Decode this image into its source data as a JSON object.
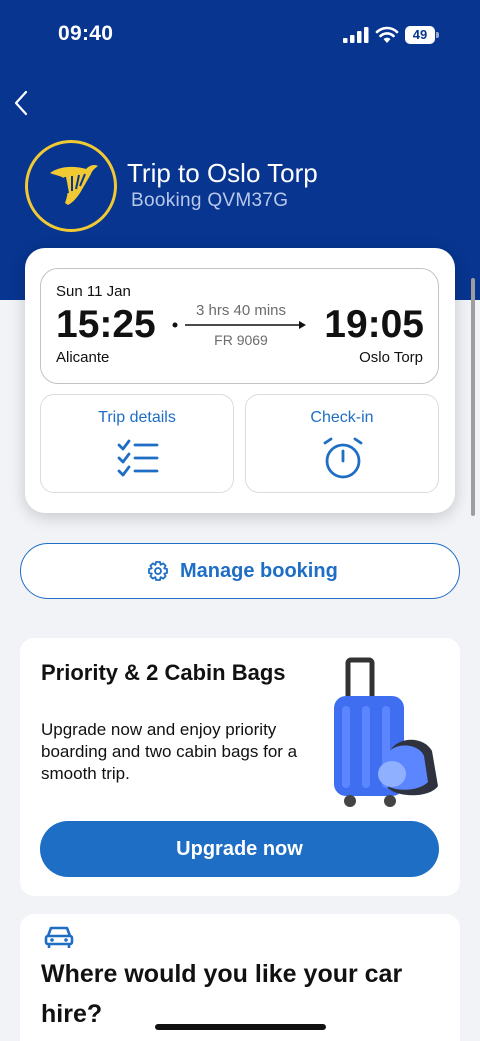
{
  "status_bar": {
    "time": "09:40",
    "battery": "49"
  },
  "header": {
    "title": "Trip to Oslo Torp",
    "booking": "Booking QVM37G",
    "brand_color": "#073590",
    "logo_accent": "#f1c933"
  },
  "flight": {
    "date": "Sun 11 Jan",
    "departure_time": "15:25",
    "arrival_time": "19:05",
    "origin": "Alicante",
    "destination": "Oslo Torp",
    "duration": "3 hrs 40 mins",
    "flight_number": "FR 9069"
  },
  "actions": {
    "trip_details": "Trip details",
    "check_in": "Check-in"
  },
  "manage_booking": "Manage booking",
  "promo": {
    "title": "Priority & 2 Cabin Bags",
    "text": "Upgrade now and enjoy priority boarding and two cabin bags for a smooth trip.",
    "button": "Upgrade now"
  },
  "car_hire": {
    "title": "Where would you like your car hire?"
  },
  "accent_color": "#1e6ec6"
}
